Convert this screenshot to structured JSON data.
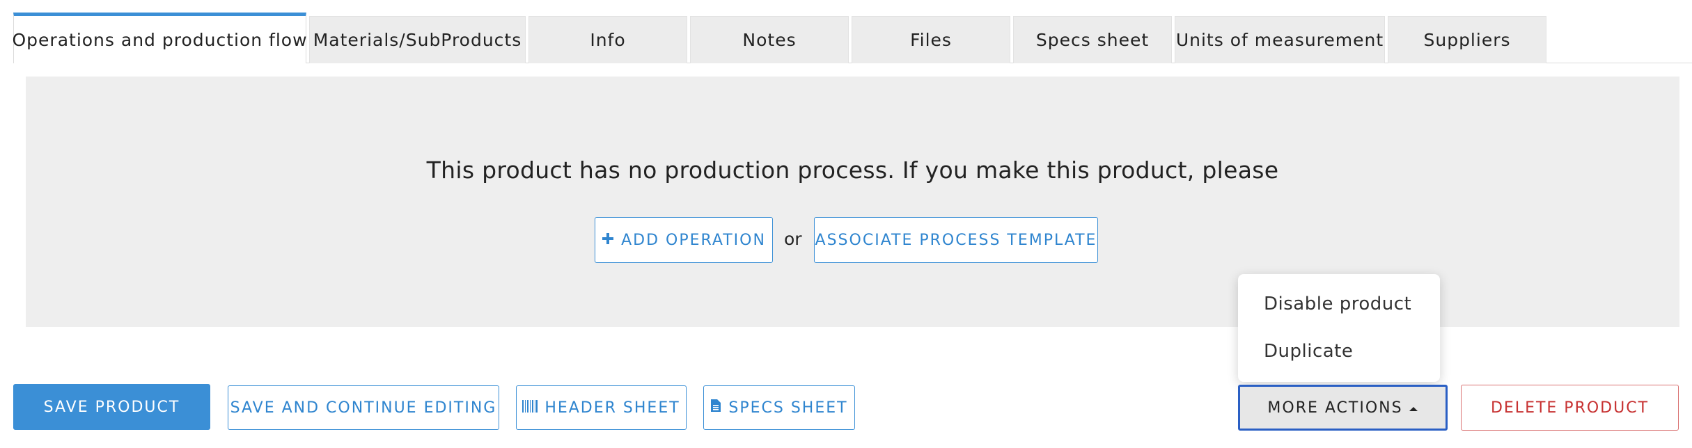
{
  "tabs": [
    {
      "label": "Operations and production flow",
      "active": true
    },
    {
      "label": "Materials/SubProducts"
    },
    {
      "label": "Info"
    },
    {
      "label": "Notes"
    },
    {
      "label": "Files"
    },
    {
      "label": "Specs sheet"
    },
    {
      "label": "Units of measurement"
    },
    {
      "label": "Suppliers"
    }
  ],
  "panel": {
    "message": "This product has no production process. If you make this product, please",
    "add_operation_label": "ADD OPERATION",
    "or_text": "or",
    "associate_template_label": "ASSOCIATE PROCESS TEMPLATE"
  },
  "dropdown": {
    "items": [
      "Disable product",
      "Duplicate"
    ]
  },
  "actions": {
    "save_product": "SAVE PRODUCT",
    "save_continue": "SAVE AND CONTINUE EDITING",
    "header_sheet": "HEADER SHEET",
    "specs_sheet": "SPECS SHEET",
    "more_actions": "MORE ACTIONS",
    "delete_product": "DELETE PRODUCT"
  },
  "icons": {
    "add": "plus-icon",
    "header_sheet": "barcode-icon",
    "specs_sheet": "file-icon",
    "more_actions": "caret-up-icon"
  },
  "colors": {
    "accent": "#3b8fd6",
    "danger": "#c73131",
    "focus": "#2a5fc4"
  }
}
